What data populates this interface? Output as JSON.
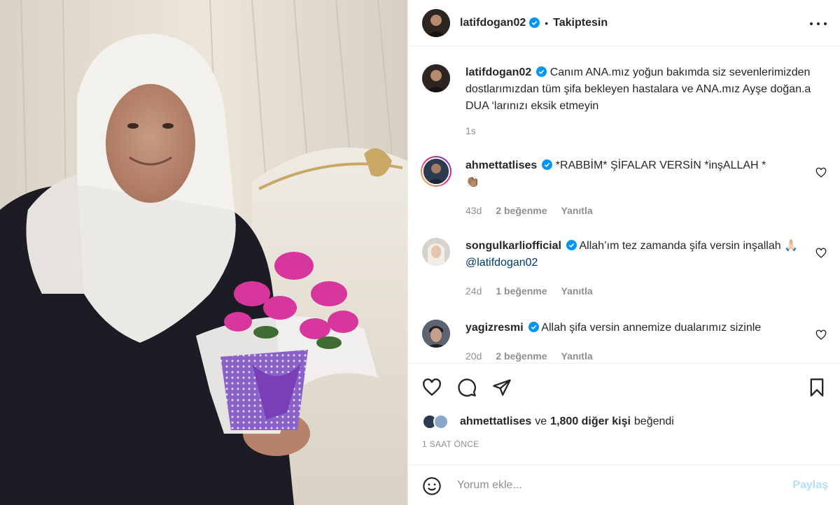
{
  "post_author": {
    "username": "latifdogan02",
    "verified": true,
    "separator": "•",
    "follow_status": "Takiptesin"
  },
  "caption": {
    "username": "latifdogan02",
    "text": "Canım ANA.mız yoğun bakımda siz sevenlerimizden dostlarımızdan tüm şifa bekleyen hastalara ve ANA.mız Ayşe doğan.a DUA ‘larınızı eksik etmeyin",
    "time": "1s"
  },
  "comments": [
    {
      "username": "ahmettatlises",
      "verified": true,
      "text": "*RABBİM* ŞİFALAR VERSİN *inşALLAH *",
      "emoji": "👏🏽",
      "time": "43d",
      "likes": "2 beğenme",
      "reply": "Yanıtla"
    },
    {
      "username": "songulkarliofficial",
      "verified": true,
      "text": "Allah’ım tez zamanda şifa versin inşallah 🙏🏻",
      "mention": "@latifdogan02",
      "time": "24d",
      "likes": "1 beğenme",
      "reply": "Yanıtla"
    },
    {
      "username": "yagizresmi",
      "verified": true,
      "text": "Allah şifa versin annemize dualarımız sizinle",
      "time": "20d",
      "likes": "2 beğenme",
      "reply": "Yanıtla"
    }
  ],
  "likes_summary": {
    "first_liker": "ahmettatlises",
    "connector": "ve",
    "others": "1,800 diğer kişi",
    "suffix": "beğendi"
  },
  "post_time": "1 SAAT ÖNCE",
  "compose": {
    "placeholder": "Yorum ekle...",
    "post_label": "Paylaş"
  },
  "icons": {
    "like": "heart-icon",
    "comment": "comment-icon",
    "share": "paper-plane-icon",
    "save": "bookmark-icon",
    "more": "more-options-icon",
    "emoji": "emoji-icon",
    "verified": "verified-badge-icon"
  },
  "colors": {
    "verified_blue": "#0095f6",
    "muted_text": "#8e8e8e",
    "post_disabled": "#b2dffc",
    "mention": "#00376b"
  }
}
